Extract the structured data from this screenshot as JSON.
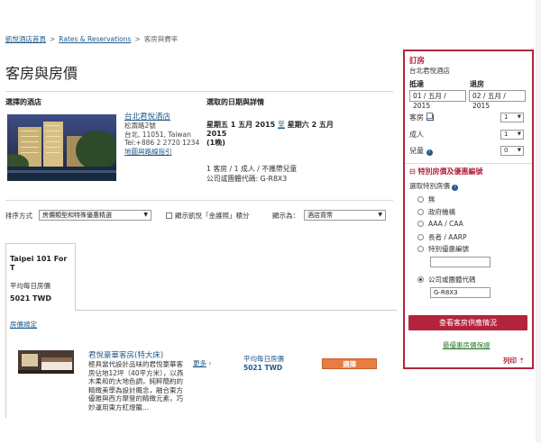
{
  "breadcrumb": {
    "home": "凱悅酒店首頁",
    "rates": "Rates & Reservations",
    "current": "客房與費率",
    "sep": ">"
  },
  "page_title": "客房與房價",
  "hotel_section": {
    "heading": "選擇的酒店",
    "name": "台北君悅酒店",
    "address_lines": [
      "松壽路2號",
      "台北, 11051, Taiwan",
      "Tel:+886 2 2720 1234"
    ],
    "map_link": "地圖與路線指引"
  },
  "dates_section": {
    "heading": "選取的日期與詳情",
    "checkin": "星期五 1 五月 2015",
    "to": "至",
    "checkout": "星期六 2 五月",
    "checkout_year": "2015",
    "nights": "(1晚)",
    "guests": "1 客房 / 1 成人 / 不攜帶兒童",
    "corp_code": "公司或團體代碼: G-R8X3"
  },
  "filter_bar": {
    "sort_label": "排序方式",
    "sort_value": "房價類型和特殊優惠精選",
    "show_points": "顯示凱悅「金護照」積分",
    "show_as_label": "顯示為：",
    "currency": "酒店貨幣"
  },
  "tab": {
    "city": "Taipei 101 For T",
    "avg_label": "平均每日房價",
    "avg_price": "5021 TWD"
  },
  "rate_rules": "房價規定",
  "room": {
    "name": "君悅豪華客房(特大床)",
    "description": "極具當代設計品味的君悅豪華客房佔地12坪（40平方米），以燕木柔和的大地色調，純粹簡約的精緻美學為設計概念，融合東方優雅與西方摩登的精緻元素，巧妙運用東方紅燈籠...",
    "more": "更多",
    "avg_label": "平均每日房價",
    "price": "5021 TWD",
    "select": "選擇"
  },
  "panel": {
    "title": "訂房",
    "hotel": "台北君悅酒店",
    "checkin_label": "抵達",
    "checkout_label": "退房",
    "checkin_value": "01 / 五月 / 2015",
    "checkout_value": "02 / 五月 / 2015",
    "rooms_label": "客房",
    "rooms": "1",
    "adults_label": "成人",
    "adults": "1",
    "children_label": "兒童",
    "children": "0",
    "special_heading": "特別房價及優惠編號",
    "select_special": "選取特別房價",
    "options": [
      "無",
      "政府機構",
      "AAA / CAA",
      "長者 / AARP",
      "特別優惠編號",
      "公司或團體代碼"
    ],
    "corp_code": "G-R8X3",
    "check_btn": "查看客房供應情況",
    "best_rate": "最優惠房價保證",
    "print": "列印"
  },
  "colors": {
    "brand": "#b3253d",
    "link": "#1f5a8c",
    "select_btn": "#e97c41"
  }
}
